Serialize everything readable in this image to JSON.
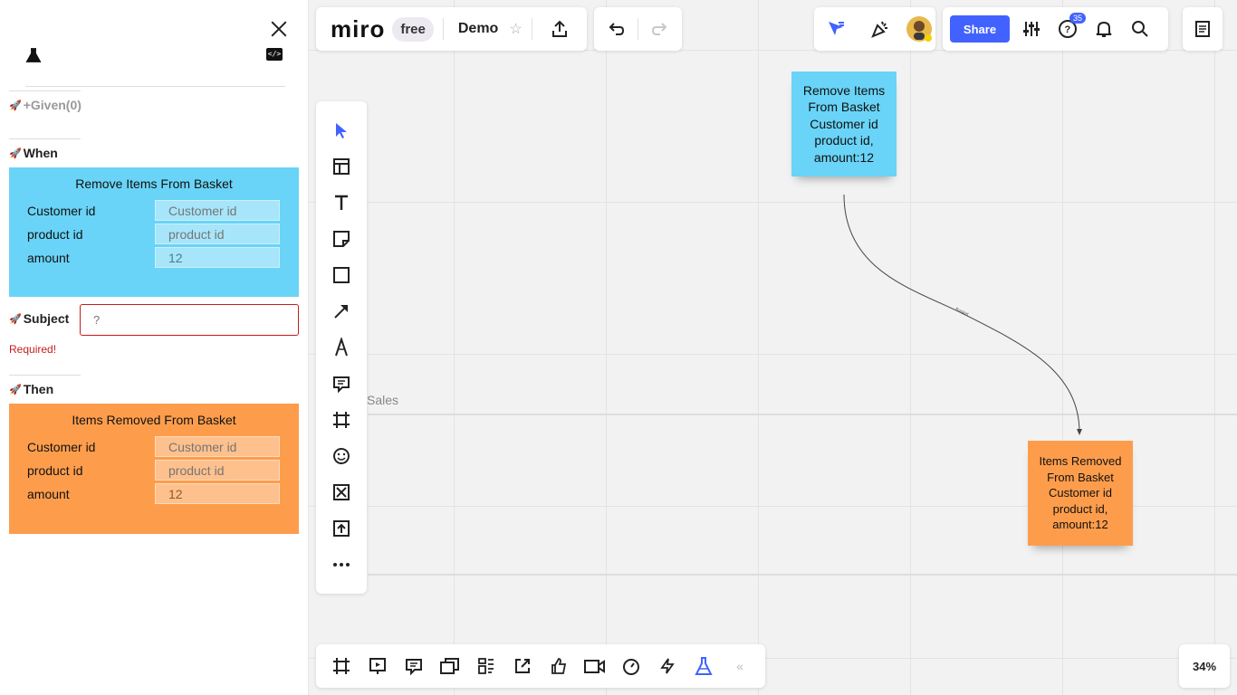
{
  "app": {
    "logo": "miro",
    "plan": "free",
    "board_name": "Demo",
    "share_label": "Share",
    "notifications_count": "35",
    "zoom": "34%"
  },
  "panel": {
    "given_label": "+Given(0)",
    "when_label": "When",
    "subject_label": "Subject",
    "then_label": "Then",
    "subject_placeholder": "?",
    "required_text": "Required!",
    "when_card": {
      "title": "Remove Items From Basket",
      "color": "#69d4f7",
      "fields": [
        {
          "label": "Customer id",
          "placeholder": "Customer id",
          "value": ""
        },
        {
          "label": "product id",
          "placeholder": "product id",
          "value": ""
        },
        {
          "label": "amount",
          "placeholder": "",
          "value": "12"
        }
      ]
    },
    "then_card": {
      "title": "Items Removed From Basket",
      "color": "#fd9d4c",
      "fields": [
        {
          "label": "Customer id",
          "placeholder": "Customer id",
          "value": ""
        },
        {
          "label": "product id",
          "placeholder": "product id",
          "value": ""
        },
        {
          "label": "amount",
          "placeholder": "",
          "value": "12"
        }
      ]
    }
  },
  "board": {
    "lane_label": "Sales",
    "connector_label": "Basket",
    "sticky_command": {
      "lines": [
        "Remove Items",
        "From Basket",
        "Customer id",
        "product id,",
        "amount:12"
      ],
      "color": "#69d4f7"
    },
    "sticky_event": {
      "lines": [
        "Items Removed",
        "From Basket",
        "Customer id",
        "product id,",
        "amount:12"
      ],
      "color": "#fd9d4c"
    }
  },
  "icons": {
    "left_toolbar": [
      "select-icon",
      "templates-icon",
      "text-icon",
      "sticky-note-icon",
      "shapes-icon",
      "connector-icon",
      "pen-icon",
      "comment-icon",
      "frame-icon",
      "emoji-icon",
      "card-icon",
      "upload-icon",
      "more-icon"
    ],
    "bottom_toolbar": [
      "frames-icon",
      "presentation-icon",
      "comments-icon",
      "cards-icon",
      "kanban-icon",
      "share-out-icon",
      "vote-icon",
      "video-icon",
      "timer-icon",
      "lightning-icon",
      "flask-icon",
      "collapse-icon"
    ]
  },
  "colors": {
    "accent": "#4262ff",
    "error": "#c81b1b"
  }
}
